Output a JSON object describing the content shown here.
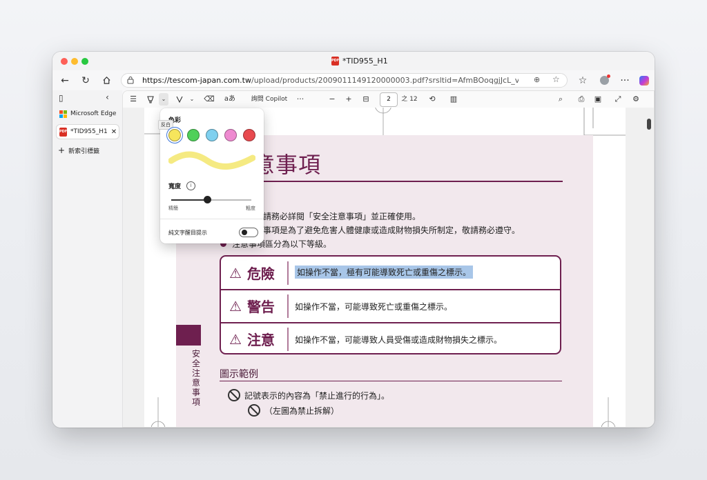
{
  "window": {
    "title": "*TID955_H1"
  },
  "browser": {
    "url_host": "https://tescom-japan.com.tw",
    "url_path": "/upload/products/2009011149120000003.pdf?srsltid=AfmBOoqgjJcL_vLftttZ9jeyfi9VOB_Yb...",
    "icons": [
      "back-icon",
      "refresh-icon",
      "home-icon",
      "lock-icon",
      "zoom-icon",
      "favorite-icon",
      "favorites-list-icon",
      "profile-icon",
      "more-icon",
      "copilot-icon"
    ]
  },
  "sidebar": {
    "tabs": [
      {
        "label": "Microsoft Edge",
        "icon": "microsoft-icon"
      },
      {
        "label": "*TID955_H1",
        "icon": "pdf-icon"
      }
    ],
    "new_tab_label": "新索引標籤"
  },
  "pdf_toolbar": {
    "copilot_label": "詢問 Copilot",
    "text_icon_label": "aあ",
    "page_current": "2",
    "page_total": "之 12"
  },
  "highlight_popup": {
    "heading": "色彩",
    "tooltip": "反白",
    "colors": [
      "#f6e55c",
      "#4fd05a",
      "#7fd0ef",
      "#ee8ad0",
      "#e84a4f"
    ],
    "selected_color_index": 0,
    "preview_color": "#f5ea82",
    "width_label": "寬度",
    "width_min_label": "精簡",
    "width_max_label": "粗度",
    "width_value": 0.45,
    "text_only_label": "純文字醒目提示",
    "text_only_enabled": false
  },
  "document": {
    "title": "注意事項",
    "bullets": [
      "，請務必詳閱「安全注意事項」並正確使用。",
      "意事項是為了避免危害人體健康或造成財物損失所制定，敬請務必遵守。",
      "注意事項區分為以下等級。"
    ],
    "warnings": [
      {
        "label": "危險",
        "text": "如操作不當，極有可能導致死亡或重傷之標示。",
        "selected": true
      },
      {
        "label": "警告",
        "text": "如操作不當，可能導致死亡或重傷之標示。",
        "selected": false
      },
      {
        "label": "注意",
        "text": "如操作不當，可能導致人員受傷或造成財物損失之標示。",
        "selected": false
      }
    ],
    "figure_section_title": "圖示範例",
    "figure_line1": "記號表示的內容為「禁止進行的行為」。",
    "figure_line2": "（左圖為禁止拆解）",
    "side_label": "安全注意事項",
    "accent_color": "#6e1f4f"
  }
}
